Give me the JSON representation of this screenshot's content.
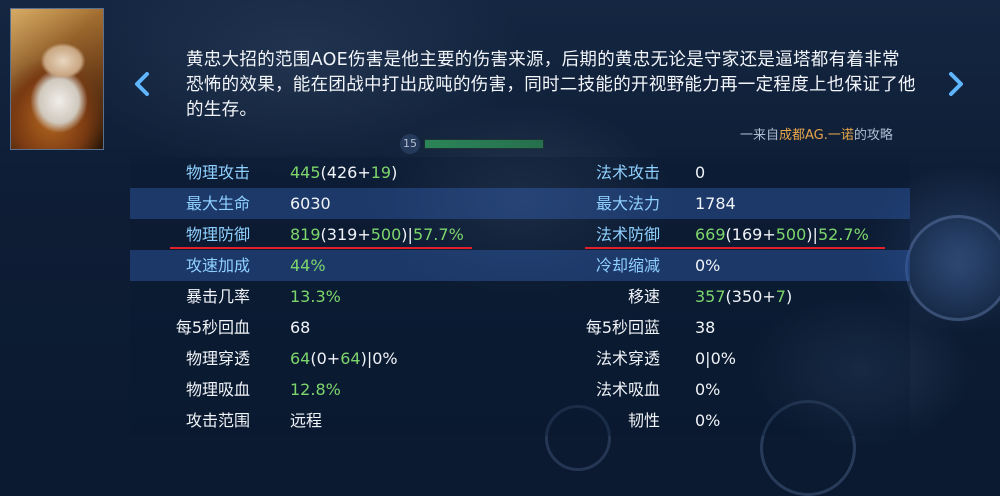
{
  "description": "黄忠大招的范围AOE伤害是他主要的伤害来源，后期的黄忠无论是守家还是逼塔都有着非常恐怖的效果，能在团战中打出成吨的伤害，同时二技能的开视野能力再一定程度上也保证了他的生存。",
  "source": {
    "prefix": "一来自",
    "author": "成都AG.一诺",
    "suffix": "的攻略"
  },
  "level_badge": "15",
  "nav": {
    "prev_icon": "chevron-left-icon",
    "next_icon": "chevron-right-icon"
  },
  "stats": [
    {
      "left": {
        "label": "物理攻击",
        "total": "445",
        "open": "(",
        "base": "426",
        "plus": "+",
        "bonus": "19",
        "close": ")",
        "sep": "",
        "pct": ""
      },
      "right": {
        "label": "法术攻击",
        "plain": "0"
      }
    },
    {
      "left": {
        "label": "最大生命",
        "plain": "6030"
      },
      "right": {
        "label": "最大法力",
        "plain": "1784"
      }
    },
    {
      "left": {
        "label": "物理防御",
        "total": "819",
        "open": "(",
        "base": "319",
        "plus": "+",
        "bonus": "500",
        "close": ")",
        "sep": "|",
        "pct": "57.7%"
      },
      "right": {
        "label": "法术防御",
        "total": "669",
        "open": "(",
        "base": "169",
        "plus": "+",
        "bonus": "500",
        "close": ")",
        "sep": "|",
        "pct": "52.7%"
      }
    },
    {
      "left": {
        "label": "攻速加成",
        "green": "44%"
      },
      "right": {
        "label": "冷却缩减",
        "plain": "0%"
      }
    },
    {
      "left": {
        "label": "暴击几率",
        "green": "13.3%"
      },
      "right": {
        "label": "移速",
        "total": "357",
        "open": "(",
        "base": "350",
        "plus": "+",
        "bonus": "7",
        "close": ")"
      }
    },
    {
      "left": {
        "label": "每5秒回血",
        "plain": "68"
      },
      "right": {
        "label": "每5秒回蓝",
        "plain": "38"
      }
    },
    {
      "left": {
        "label": "物理穿透",
        "total": "64",
        "open": "(",
        "base": "0",
        "plus": "+",
        "bonus": "64",
        "close": ")",
        "tail": "|0%"
      },
      "right": {
        "label": "法术穿透",
        "plain": "0|0%"
      }
    },
    {
      "left": {
        "label": "物理吸血",
        "green": "12.8%"
      },
      "right": {
        "label": "法术吸血",
        "plain": "0%"
      }
    },
    {
      "left": {
        "label": "攻击范围",
        "plain": "远程"
      },
      "right": {
        "label": "韧性",
        "plain": "0%"
      }
    }
  ],
  "colors": {
    "label_blue": "#8fd0ff",
    "value_green": "#7dd66c",
    "highlight_row": "#28509a",
    "underline_red": "#e0202a",
    "author_orange": "#e8a64a"
  }
}
